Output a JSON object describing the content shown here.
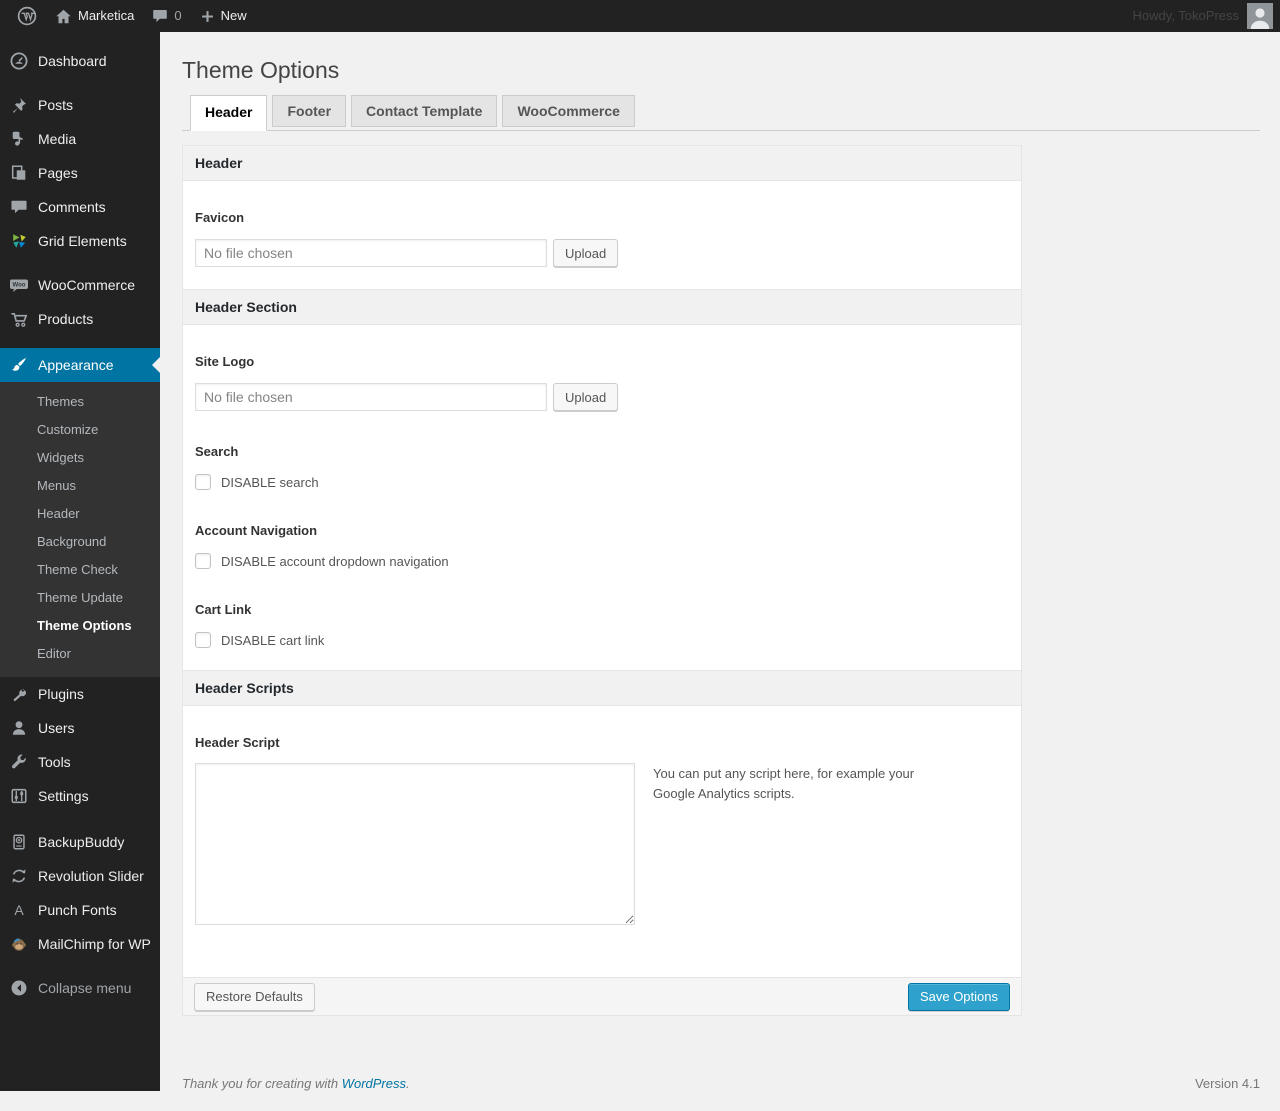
{
  "admin_bar": {
    "site_name": "Marketica",
    "comments_count": "0",
    "new_label": "New",
    "howdy_text": "Howdy, TokoPress"
  },
  "sidebar": {
    "items": [
      {
        "label": "Dashboard"
      },
      {
        "label": "Posts"
      },
      {
        "label": "Media"
      },
      {
        "label": "Pages"
      },
      {
        "label": "Comments"
      },
      {
        "label": "Grid Elements"
      },
      {
        "label": "WooCommerce"
      },
      {
        "label": "Products"
      },
      {
        "label": "Appearance",
        "active": true
      },
      {
        "label": "Plugins"
      },
      {
        "label": "Users"
      },
      {
        "label": "Tools"
      },
      {
        "label": "Settings"
      },
      {
        "label": "BackupBuddy"
      },
      {
        "label": "Revolution Slider"
      },
      {
        "label": "Punch Fonts"
      },
      {
        "label": "MailChimp for WP"
      },
      {
        "label": "Collapse menu"
      }
    ],
    "appearance_submenu": [
      {
        "label": "Themes"
      },
      {
        "label": "Customize"
      },
      {
        "label": "Widgets"
      },
      {
        "label": "Menus"
      },
      {
        "label": "Header"
      },
      {
        "label": "Background"
      },
      {
        "label": "Theme Check"
      },
      {
        "label": "Theme Update"
      },
      {
        "label": "Theme Options",
        "current": true
      },
      {
        "label": "Editor"
      }
    ]
  },
  "main": {
    "title": "Theme Options",
    "tabs": [
      {
        "label": "Header",
        "active": true
      },
      {
        "label": "Footer"
      },
      {
        "label": "Contact Template"
      },
      {
        "label": "WooCommerce"
      }
    ],
    "panel": {
      "sections": [
        {
          "title": "Header"
        },
        {
          "title": "Header Section"
        },
        {
          "title": "Header Scripts"
        }
      ],
      "fields": {
        "favicon": {
          "label": "Favicon",
          "value_placeholder": "No file chosen",
          "button_label": "Upload"
        },
        "site_logo": {
          "label": "Site Logo",
          "value_placeholder": "No file chosen",
          "button_label": "Upload"
        },
        "search": {
          "label": "Search",
          "checkbox_label": "DISABLE search",
          "checked": false
        },
        "account_navigation": {
          "label": "Account Navigation",
          "checkbox_label": "DISABLE account dropdown navigation",
          "checked": false
        },
        "cart_link": {
          "label": "Cart Link",
          "checkbox_label": "DISABLE cart link",
          "checked": false
        },
        "header_script": {
          "label": "Header Script",
          "value": "",
          "help_text": "You can put any script here, for example your Google Analytics scripts."
        }
      },
      "footer": {
        "restore_label": "Restore Defaults",
        "save_label": "Save Options"
      }
    }
  },
  "page_footer": {
    "thanks_text": "Thank you for creating with ",
    "wordpress_link": "WordPress",
    "period": ".",
    "version": "Version 4.1"
  },
  "colors": {
    "accent_blue": "#0074a2",
    "primary_button": "#2ea2cc",
    "admin_bar_bg": "#222222",
    "submenu_bg": "#333333",
    "content_bg": "#f1f1f1"
  },
  "icons": {
    "admin_bar": [
      "wordpress-logo-icon",
      "home-icon",
      "comments-bubble-icon",
      "plus-icon",
      "avatar"
    ],
    "sidebar": [
      "dashboard-icon",
      "pushpin-icon",
      "media-icon",
      "pages-icon",
      "comments-icon",
      "grid-elements-icon",
      "woocommerce-icon",
      "cart-icon",
      "brush-icon",
      "plugin-icon",
      "users-icon",
      "tools-icon",
      "settings-icon",
      "backupbuddy-icon",
      "refresh-icon",
      "letter-a-icon",
      "mailchimp-icon",
      "collapse-arrow-icon"
    ]
  }
}
